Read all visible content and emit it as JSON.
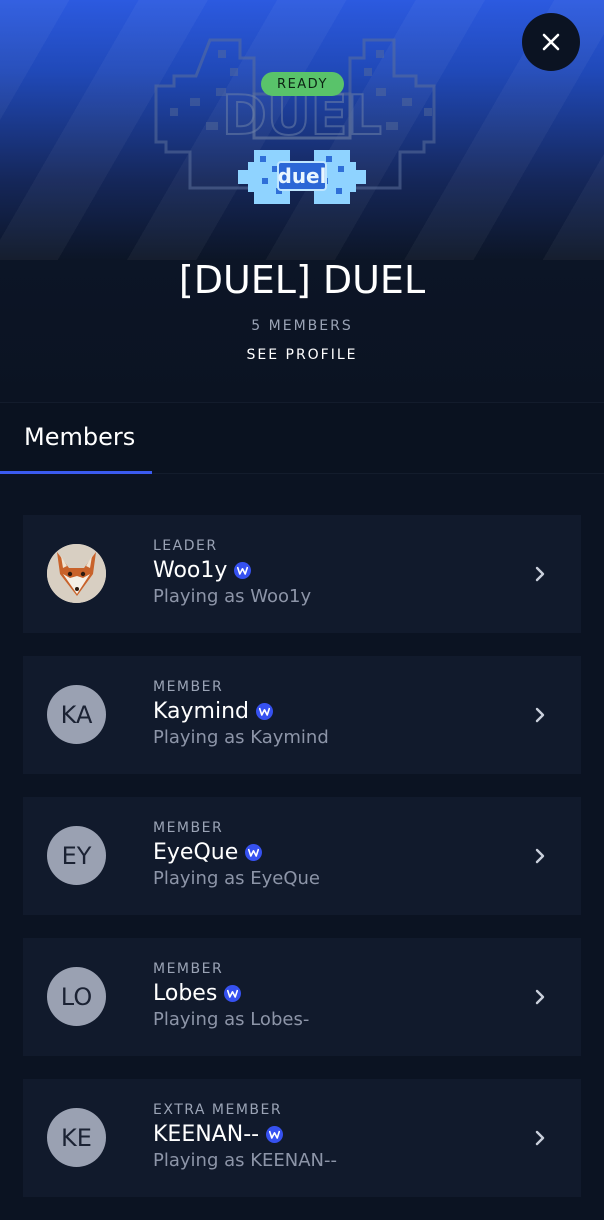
{
  "header": {
    "status_badge": "READY",
    "logo_text": "duel",
    "team_name": "[DUEL] DUEL",
    "member_count": "5 MEMBERS",
    "see_profile": "SEE PROFILE"
  },
  "icons": {
    "close": "close-icon",
    "verified": "verified-badge-icon",
    "chevron": "chevron-right-icon"
  },
  "tabs": [
    {
      "label": "Members",
      "active": true
    }
  ],
  "members": [
    {
      "role": "LEADER",
      "name": "Woo1y",
      "playing": "Playing as Woo1y",
      "initials": "",
      "avatar": "fox-photo"
    },
    {
      "role": "MEMBER",
      "name": "Kaymind",
      "playing": "Playing as Kaymind",
      "initials": "KA"
    },
    {
      "role": "MEMBER",
      "name": "EyeQue",
      "playing": "Playing as EyeQue",
      "initials": "EY"
    },
    {
      "role": "MEMBER",
      "name": "Lobes",
      "playing": "Playing as Lobes-",
      "initials": "LO"
    },
    {
      "role": "EXTRA MEMBER",
      "name": "KEENAN--",
      "playing": "Playing as KEENAN--",
      "initials": "KE"
    }
  ],
  "colors": {
    "background": "#0b1322",
    "card": "#111a2c",
    "accent": "#3b5bf0",
    "ready": "#59c36a",
    "hero_top": "#2c5ae0"
  }
}
